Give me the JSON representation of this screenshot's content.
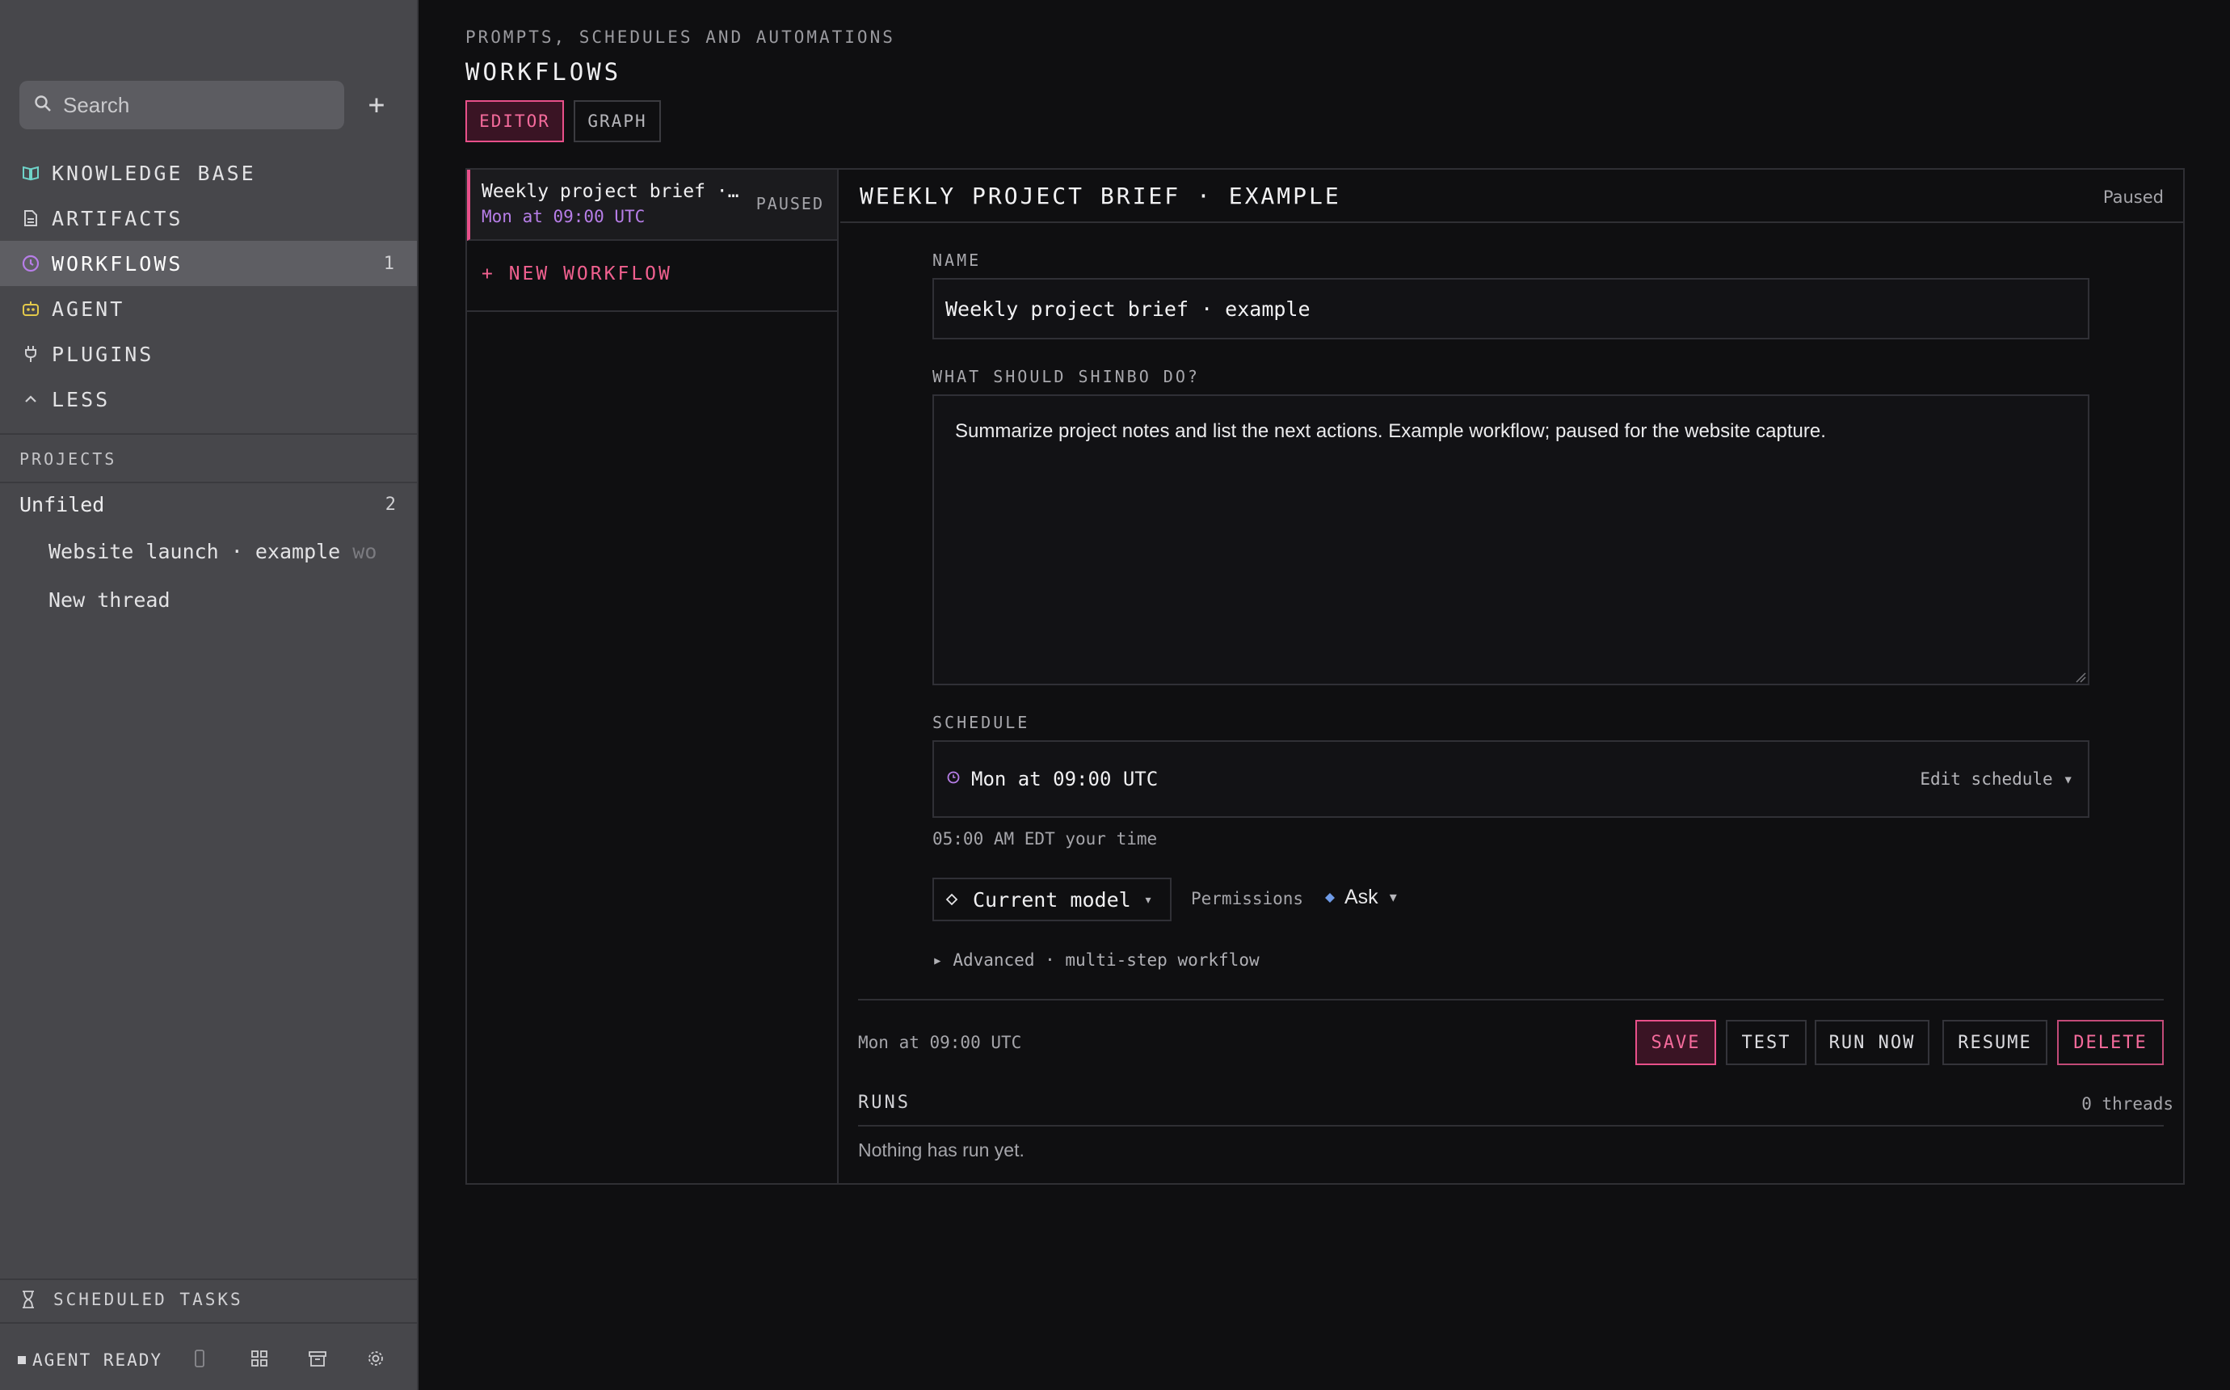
{
  "sidebar": {
    "search_placeholder": "Search",
    "nav": [
      {
        "label": "KNOWLEDGE BASE",
        "icon": "book-icon",
        "color": "#6fd3c9"
      },
      {
        "label": "ARTIFACTS",
        "icon": "document-icon",
        "color": "#cfcfd2"
      },
      {
        "label": "WORKFLOWS",
        "icon": "clock-icon",
        "color": "#b77ee8",
        "count": "1",
        "active": true
      },
      {
        "label": "AGENT",
        "icon": "robot-icon",
        "color": "#e3c94a"
      },
      {
        "label": "PLUGINS",
        "icon": "plug-icon",
        "color": "#cfcfd2"
      },
      {
        "label": "LESS",
        "icon": "chevron-up-icon",
        "color": "#cfcfd2"
      }
    ],
    "projects_label": "PROJECTS",
    "unfiled": {
      "label": "Unfiled",
      "count": "2"
    },
    "threads": [
      {
        "label": "Website launch · example ",
        "fade": "wo"
      },
      {
        "label": "New thread",
        "fade": ""
      }
    ],
    "scheduled_tasks": "SCHEDULED TASKS",
    "agent_status": "AGENT READY"
  },
  "header": {
    "eyebrow": "PROMPTS, SCHEDULES AND AUTOMATIONS",
    "title": "WORKFLOWS",
    "tabs": [
      {
        "label": "EDITOR",
        "active": true
      },
      {
        "label": "GRAPH",
        "active": false
      }
    ]
  },
  "list": {
    "items": [
      {
        "name": "Weekly project brief ·…",
        "schedule": "Mon at 09:00 UTC",
        "status": "PAUSED"
      }
    ],
    "new_label": "+ NEW WORKFLOW"
  },
  "detail": {
    "title": "WEEKLY PROJECT BRIEF · EXAMPLE",
    "status": "Paused",
    "name_label": "NAME",
    "name_value": "Weekly project brief · example",
    "prompt_label": "WHAT SHOULD SHINBO DO?",
    "prompt_value": "Summarize project notes and list the next actions. Example workflow; paused for the website capture.",
    "schedule_label": "SCHEDULE",
    "schedule_value": "Mon at 09:00 UTC",
    "edit_schedule": "Edit schedule ▾",
    "local_time": "05:00 AM EDT your time",
    "model_label": "Current model",
    "permissions_label": "Permissions",
    "permissions_value": "Ask",
    "advanced": "Advanced · multi-step workflow",
    "footer_schedule": "Mon at 09:00 UTC",
    "actions": {
      "save": "SAVE",
      "test": "TEST",
      "run_now": "RUN NOW",
      "resume": "RESUME",
      "delete": "DELETE"
    },
    "runs_label": "RUNS",
    "runs_count": "0 threads",
    "runs_empty": "Nothing has run yet."
  },
  "colors": {
    "accent": "#e8508a",
    "schedule_accent": "#b77ee8",
    "permission_diamond": "#6f9be8"
  }
}
